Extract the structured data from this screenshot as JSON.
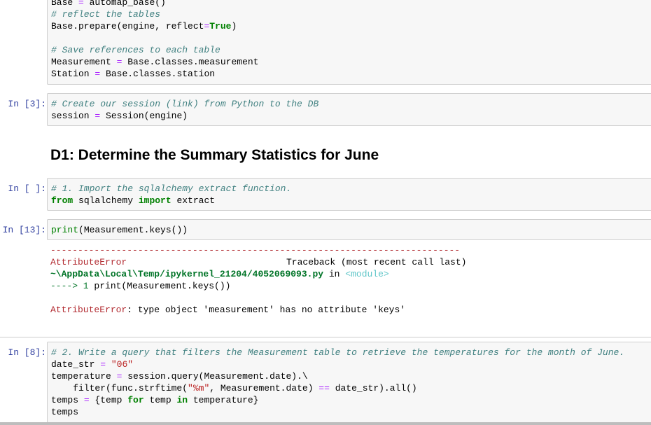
{
  "cells": [
    {
      "prompt": "",
      "lines": [
        [
          [
            "Base ",
            "n"
          ],
          [
            "=",
            "o"
          ],
          [
            " automap_base()",
            "n"
          ]
        ],
        [
          [
            "# reflect the tables",
            "c"
          ]
        ],
        [
          [
            "Base.prepare(engine, reflect",
            "n"
          ],
          [
            "=",
            "o"
          ],
          [
            "True",
            "k"
          ],
          [
            ")",
            "n"
          ]
        ],
        [],
        [
          [
            "# Save references to each table",
            "c"
          ]
        ],
        [
          [
            "Measurement ",
            "n"
          ],
          [
            "=",
            "o"
          ],
          [
            " Base.classes.measurement",
            "n"
          ]
        ],
        [
          [
            "Station ",
            "n"
          ],
          [
            "=",
            "o"
          ],
          [
            " Base.classes.station",
            "n"
          ]
        ]
      ]
    },
    {
      "prompt": "In [3]:",
      "lines": [
        [
          [
            "# Create our session (link) from Python to the DB",
            "c"
          ]
        ],
        [
          [
            "session ",
            "n"
          ],
          [
            "=",
            "o"
          ],
          [
            " Session(engine)",
            "n"
          ]
        ]
      ]
    },
    {
      "prompt": "In [ ]:",
      "lines": [
        [
          [
            "# 1. Import the sqlalchemy extract function.",
            "c"
          ]
        ],
        [
          [
            "from",
            "k"
          ],
          [
            " sqlalchemy ",
            "n"
          ],
          [
            "import",
            "k"
          ],
          [
            " extract",
            "n"
          ]
        ]
      ]
    },
    {
      "prompt": "In [13]:",
      "lines": [
        [
          [
            "print",
            "kw"
          ],
          [
            "(Measurement.keys())",
            "n"
          ]
        ]
      ]
    },
    {
      "prompt": "In [8]:",
      "lines": [
        [
          [
            "# 2. Write a query that filters the Measurement table to retrieve the temperatures for the month of June.",
            "c"
          ]
        ],
        [
          [
            "date_str ",
            "n"
          ],
          [
            "=",
            "o"
          ],
          [
            " ",
            "n"
          ],
          [
            "\"06\"",
            "s"
          ]
        ],
        [
          [
            "temperature ",
            "n"
          ],
          [
            "=",
            "o"
          ],
          [
            " session.query(Measurement.date).\\",
            "n"
          ]
        ],
        [
          [
            "    filter(func.strftime(",
            "n"
          ],
          [
            "\"%m\"",
            "s"
          ],
          [
            ", Measurement.date) ",
            "n"
          ],
          [
            "==",
            "o"
          ],
          [
            " date_str).all()",
            "n"
          ]
        ],
        [
          [
            "temps ",
            "n"
          ],
          [
            "=",
            "o"
          ],
          [
            " {temp ",
            "n"
          ],
          [
            "for",
            "k"
          ],
          [
            " temp ",
            "n"
          ],
          [
            "in",
            "k"
          ],
          [
            " temperature}",
            "n"
          ]
        ],
        [
          [
            "temps",
            "n"
          ]
        ]
      ]
    }
  ],
  "heading": "D1: Determine the Summary Statistics for June",
  "error_output": {
    "dashes": "---------------------------------------------------------------------------",
    "error_name": "AttributeError",
    "traceback_label": "Traceback (most recent call last)",
    "file_path": "~\\AppData\\Local\\Temp/ipykernel_21204/4052069093.py",
    "in_word": " in ",
    "module": "<module>",
    "arrow": "----> 1 ",
    "arrow_code": "print(Measurement.keys())",
    "final_error_name": "AttributeError",
    "final_message": ": type object 'measurement' has no attribute 'keys'"
  }
}
